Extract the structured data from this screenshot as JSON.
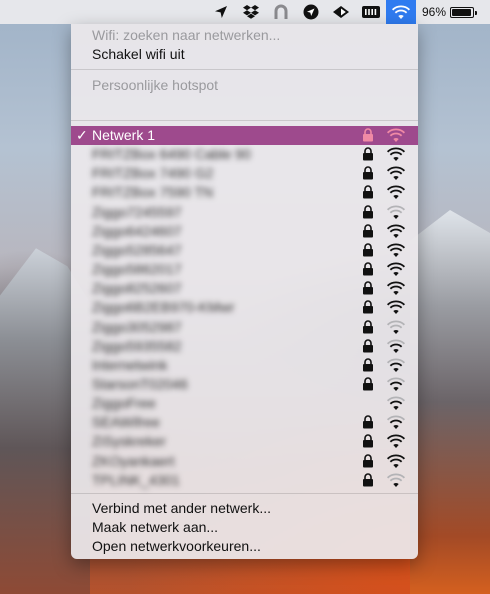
{
  "menubar": {
    "icons": [
      "location-arrow-icon",
      "dropbox-icon",
      "arch-icon",
      "navigation-circle-icon",
      "layers-icon",
      "grid-icon",
      "wifi-icon"
    ],
    "battery_percent": "96%",
    "battery_level": 0.96
  },
  "menu": {
    "wifi_status": "Wifi: zoeken naar netwerken...",
    "turn_off_wifi": "Schakel wifi uit",
    "hotspot_header": "Persoonlijke hotspot",
    "footer": {
      "join_other": "Verbind met ander netwerk...",
      "create_network": "Maak netwerk aan...",
      "open_prefs": "Open netwerkvoorkeuren..."
    }
  },
  "networks": [
    {
      "name": "Netwerk 1",
      "selected": true,
      "blurred": false,
      "locked": true,
      "signal": 3
    },
    {
      "name": "FRITZBox 6490 Cable 90",
      "selected": false,
      "blurred": true,
      "locked": true,
      "signal": 3
    },
    {
      "name": "FRITZBox 7490 G2",
      "selected": false,
      "blurred": true,
      "locked": true,
      "signal": 3
    },
    {
      "name": "FRITZBox 7590 TN",
      "selected": false,
      "blurred": true,
      "locked": true,
      "signal": 3
    },
    {
      "name": "Ziggo7245597",
      "selected": false,
      "blurred": true,
      "locked": true,
      "signal": 1
    },
    {
      "name": "Ziggo6424607",
      "selected": false,
      "blurred": true,
      "locked": true,
      "signal": 3
    },
    {
      "name": "Ziggo5285647",
      "selected": false,
      "blurred": true,
      "locked": true,
      "signal": 3
    },
    {
      "name": "Ziggo5862017",
      "selected": false,
      "blurred": true,
      "locked": true,
      "signal": 3
    },
    {
      "name": "Ziggo8252607",
      "selected": false,
      "blurred": true,
      "locked": true,
      "signal": 3
    },
    {
      "name": "Ziggo6B2EB970-KMwr",
      "selected": false,
      "blurred": true,
      "locked": true,
      "signal": 3
    },
    {
      "name": "Ziggo3052987",
      "selected": false,
      "blurred": true,
      "locked": true,
      "signal": 1
    },
    {
      "name": "Ziggo5935582",
      "selected": false,
      "blurred": true,
      "locked": true,
      "signal": 2
    },
    {
      "name": "Internetwink",
      "selected": false,
      "blurred": true,
      "locked": true,
      "signal": 2
    },
    {
      "name": "StarsonT02046",
      "selected": false,
      "blurred": true,
      "locked": true,
      "signal": 2
    },
    {
      "name": "ZiggoFree",
      "selected": false,
      "blurred": true,
      "locked": false,
      "signal": 2
    },
    {
      "name": "SEAWifree",
      "selected": false,
      "blurred": true,
      "locked": true,
      "signal": 2
    },
    {
      "name": "ZiSyskreker",
      "selected": false,
      "blurred": true,
      "locked": true,
      "signal": 3
    },
    {
      "name": "ZKOyankaert",
      "selected": false,
      "blurred": true,
      "locked": true,
      "signal": 3
    },
    {
      "name": "TPLINK_4301",
      "selected": false,
      "blurred": true,
      "locked": true,
      "signal": 1
    }
  ],
  "colors": {
    "selection": "#9e4a8d",
    "wifi_active_bg": "#2f7bf0",
    "selected_icon": "#f08aa5"
  }
}
